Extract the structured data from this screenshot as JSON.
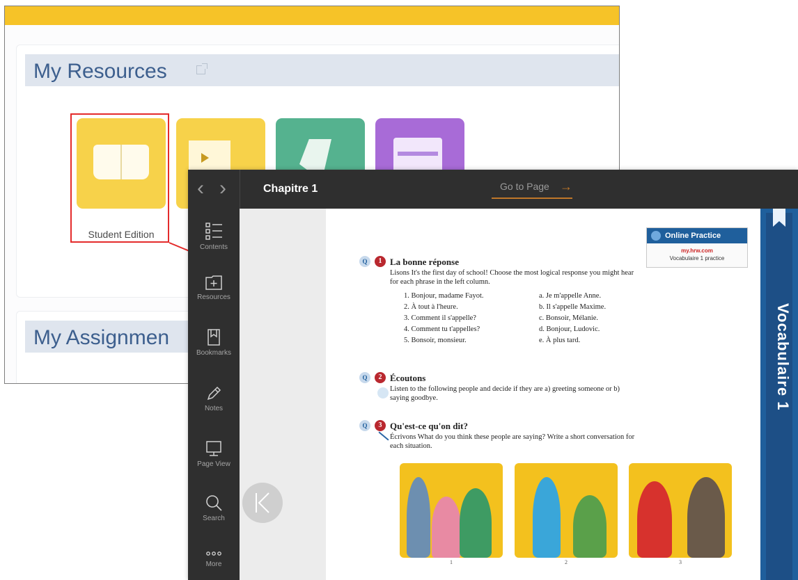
{
  "my_resources": {
    "title": "My Resources",
    "tiles": [
      {
        "label": "Student Edition",
        "icon": "open-book-icon"
      },
      {
        "label": "",
        "icon": "video-page-icon"
      },
      {
        "label": "",
        "icon": "green-folder-icon"
      },
      {
        "label": "",
        "icon": "purple-layout-icon"
      }
    ]
  },
  "my_assignments": {
    "title": "My Assignmen"
  },
  "reader": {
    "chapter": "Chapitre 1",
    "goto_page": "Go to Page",
    "sidebar": [
      {
        "label": "Contents",
        "icon": "contents-icon"
      },
      {
        "label": "Resources",
        "icon": "resources-icon"
      },
      {
        "label": "Bookmarks",
        "icon": "bookmark-icon"
      },
      {
        "label": "Notes",
        "icon": "pencil-icon"
      },
      {
        "label": "Page View",
        "icon": "monitor-icon"
      },
      {
        "label": "Search",
        "icon": "search-icon"
      },
      {
        "label": "More",
        "icon": "more-icon"
      }
    ],
    "side_title": "Vocabulaire 1",
    "online_practice": {
      "title": "Online Practice",
      "url": "my.hrw.com",
      "sub": "Vocabulaire 1 practice"
    },
    "exercises": [
      {
        "number": "1",
        "title": "La bonne réponse",
        "text": "Lisons It's the first day of school! Choose the most logical response you might hear for each phrase in the left column.",
        "pairs": [
          [
            "1. Bonjour, madame Fayot.",
            "a. Je m'appelle Anne."
          ],
          [
            "2. À tout à l'heure.",
            "b. Il s'appelle Maxime."
          ],
          [
            "3. Comment il s'appelle?",
            "c. Bonsoir, Mélanie."
          ],
          [
            "4. Comment tu t'appelles?",
            "d. Bonjour, Ludovic."
          ],
          [
            "5. Bonsoir, monsieur.",
            "e. À plus tard."
          ]
        ]
      },
      {
        "number": "2",
        "title": "Écoutons",
        "text": "Listen to the following people and decide if they are a) greeting someone or b) saying goodbye."
      },
      {
        "number": "3",
        "title": "Qu'est-ce qu'on dit?",
        "text": "Écrivons What do you think these people are saying? Write a short conversation for each situation."
      }
    ],
    "photo_numbers": [
      "1",
      "2",
      "3"
    ]
  },
  "colors": {
    "accent_yellow": "#f6c328",
    "callout_red": "#e42b2b",
    "brand_blue": "#1f5f9c",
    "dark_chrome": "#2f2f2f"
  }
}
